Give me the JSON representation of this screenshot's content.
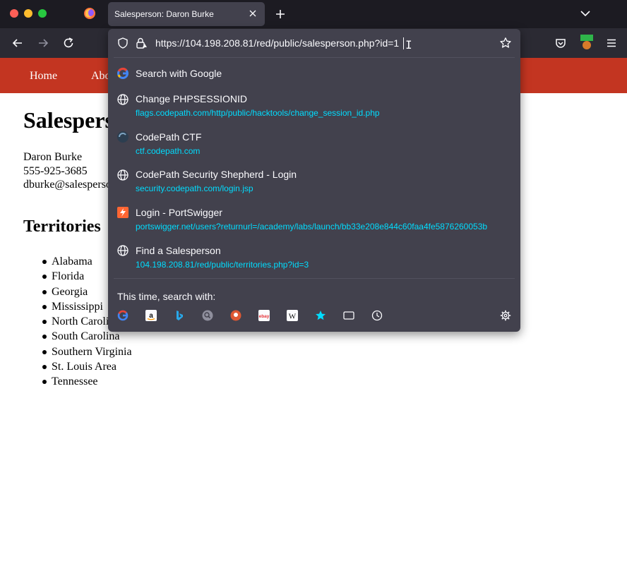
{
  "browser": {
    "tab_title": "Salesperson: Daron Burke"
  },
  "urlbar": {
    "value": "https://104.198.208.81/red/public/salesperson.php?id=1"
  },
  "suggestions": {
    "search_label": "Search with Google",
    "results": [
      {
        "title": "Change PHPSESSIONID",
        "url": "flags.codepath.com/http/public/hacktools/change_session_id.php",
        "icon": "globe-icon"
      },
      {
        "title": "CodePath CTF",
        "url": "ctf.codepath.com",
        "icon": "codepath-favicon"
      },
      {
        "title": "CodePath Security Shepherd - Login",
        "url": "security.codepath.com/login.jsp",
        "icon": "globe-icon"
      },
      {
        "title": "Login - PortSwigger",
        "url": "portswigger.net/users?returnurl=/academy/labs/launch/bb33e208e844c60faa4fe5876260053b",
        "icon": "portswigger-favicon"
      },
      {
        "title": "Find a Salesperson",
        "url": "104.198.208.81/red/public/territories.php?id=3",
        "icon": "globe-icon"
      }
    ],
    "one_off_label": "This time, search with:",
    "engines": [
      "google-icon",
      "amazon-icon",
      "bing-icon",
      "search-engine-icon",
      "duckduckgo-icon",
      "ebay-icon",
      "wikipedia-icon",
      "bookmarks-star-icon",
      "tabs-icon",
      "history-icon"
    ]
  },
  "page": {
    "nav": {
      "home": "Home",
      "about": "About"
    },
    "heading": "Salesperson",
    "name": "Daron Burke",
    "phone": "555-925-3685",
    "email": "dburke@salesperson.com",
    "territories_heading": "Territories",
    "territories": [
      "Alabama",
      "Florida",
      "Georgia",
      "Mississippi",
      "North Carolina",
      "South Carolina",
      "Southern Virginia",
      "St. Louis Area",
      "Tennessee"
    ]
  },
  "colors": {
    "nav_bar": "#c33521",
    "popup_bg": "#42414d",
    "link_url": "#00ddff",
    "toolbar_bg": "#2b2a33",
    "titlebar_bg": "#1c1b22"
  }
}
